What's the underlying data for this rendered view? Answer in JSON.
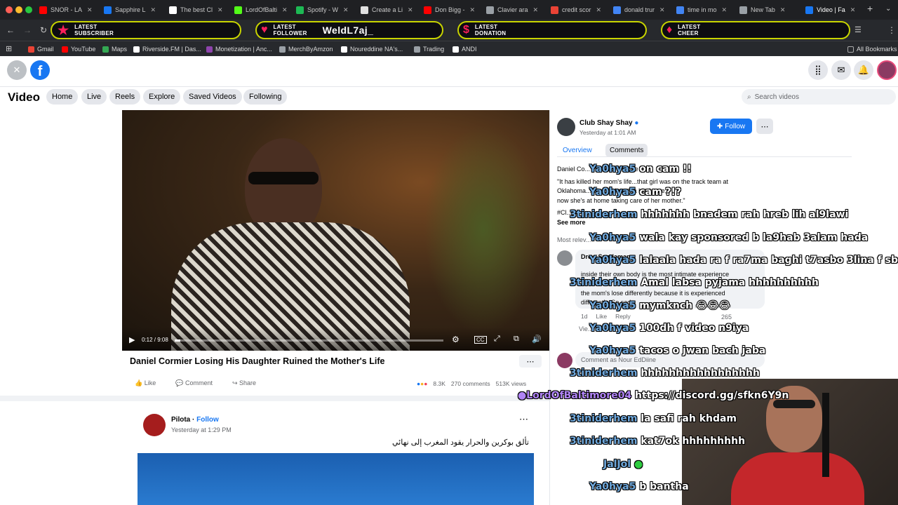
{
  "browser": {
    "tabs": [
      {
        "label": "SNOR - LA",
        "color": "#ff0000"
      },
      {
        "label": "Sapphire L",
        "color": "#1877f2"
      },
      {
        "label": "The best Cl",
        "color": "#ffffff"
      },
      {
        "label": "LordOfBalti",
        "color": "#53fc18"
      },
      {
        "label": "Spotify - W",
        "color": "#1db954"
      },
      {
        "label": "Create a Li",
        "color": "#e0e0e0"
      },
      {
        "label": "Don Bigg -",
        "color": "#ff0000"
      },
      {
        "label": "Clavier ara",
        "color": "#9aa0a6"
      },
      {
        "label": "credit scor",
        "color": "#ea4335"
      },
      {
        "label": "donald trur",
        "color": "#4285f4"
      },
      {
        "label": "time in mo",
        "color": "#4285f4"
      },
      {
        "label": "New Tab",
        "color": "#9aa0a6"
      },
      {
        "label": "Video | Fa",
        "color": "#1877f2"
      }
    ],
    "new_tab": "+"
  },
  "overlay": {
    "subscriber": {
      "title_1": "LATEST",
      "title_2": "SUBSCRIBER",
      "value": ""
    },
    "follower": {
      "title_1": "LATEST",
      "title_2": "FOLLOWER",
      "value": "WeldL7aj_"
    },
    "donation": {
      "title_1": "LATEST",
      "title_2": "DONATION",
      "value": ""
    },
    "cheer": {
      "title_1": "LATEST",
      "title_2": "CHEER",
      "value": ""
    }
  },
  "bookmarks": [
    {
      "label": "Gmail",
      "color": "#ea4335"
    },
    {
      "label": "YouTube",
      "color": "#ff0000"
    },
    {
      "label": "Maps",
      "color": "#34a853"
    },
    {
      "label": "Riverside.FM | Das...",
      "color": "#ffffff"
    },
    {
      "label": "Monetization | Anc...",
      "color": "#8e44ad"
    },
    {
      "label": "MerchByAmzon",
      "color": "#9aa0a6"
    },
    {
      "label": "Noureddine NA's...",
      "color": "#ffffff"
    },
    {
      "label": "Trading",
      "color": "#9aa0a6"
    },
    {
      "label": "ANDI",
      "color": "#ffffff"
    }
  ],
  "all_bookmarks": "All Bookmarks",
  "fb": {
    "page_title": "Video",
    "nav": [
      "Home",
      "Live",
      "Reels",
      "Explore",
      "Saved Videos",
      "Following"
    ],
    "search_placeholder": "Search videos",
    "video": {
      "time": "0:12 / 9:08",
      "title": "Daniel Cormier Losing His Daughter Ruined the Mother's Life",
      "like": "Like",
      "comment": "Comment",
      "share": "Share",
      "reactions": "8.3K",
      "comments": "270 comments",
      "views": "513K views"
    },
    "post2": {
      "author": "Pilota",
      "follow": "Follow",
      "time": "Yesterday at 1:29 PM",
      "text": "تألق بوكرين والحرار يقود المغرب إلى نهائي"
    },
    "side": {
      "author": "Club Shay Shay",
      "time": "Yesterday at 1:01 AM",
      "follow": "Follow",
      "tab_overview": "Overview",
      "tab_comments": "Comments",
      "desc_1": "Daniel Co... the Mother's Life",
      "desc_2": "\"It has killed her mom's life...that girl was on the track team at",
      "desc_3": "Oklahoma... She had such a big future,",
      "desc_4": "now she's at home taking care of her mother.\"",
      "desc_5": "#Cl...",
      "see_more": "See more",
      "most_rel": "Most relev...",
      "c1_name": "Drew Sundaman...",
      "c1_l1": "inside their own body is the most intimate experience",
      "c1_l2": "the mom's lose differently because it is experienced",
      "c1_l3": "differently. So sad.",
      "c1_time": "1d",
      "c1_like": "Like",
      "c1_reply": "Reply",
      "c1_count": "265",
      "view_more": "Vie...",
      "comment_as": "Comment as Nour EdDiine"
    }
  },
  "chat": [
    {
      "user": "Ya0hya5",
      "msg": "on cam !!"
    },
    {
      "user": "Ya0hya5",
      "msg": "cam ?!?"
    },
    {
      "user": "3tiniderhem",
      "msg": "hhhhhhh bnadem rah hreb lih al9lawi"
    },
    {
      "user": "Ya0hya5",
      "msg": "wala kay sponsored b la9hab 3alam hada"
    },
    {
      "user": "Ya0hya5",
      "msg": "lalaala hada ra f ra7ma baghi t7asbo 3lina f sba"
    },
    {
      "user": "3tiniderhem",
      "msg": "Amal labsa pyjama hhhhhhhhhh"
    },
    {
      "user": "Ya0hya5",
      "msg": "mymknch 😂😂😂"
    },
    {
      "user": "Ya0hya5",
      "msg": "100dh f video n9iya"
    },
    {
      "user": "Ya0hya5",
      "msg": "tacos o jwan bach jaba"
    },
    {
      "user": "3tiniderhem",
      "msg": "hhhhhhhhhhhhhhhhh"
    },
    {
      "user": "LordOfBaltimore04",
      "msg": "https://discord.gg/sfkn6Y9n"
    },
    {
      "user": "3tiniderhem",
      "msg": "la safi rah khdam"
    },
    {
      "user": "3tiniderhem",
      "msg": "kat7ok hhhhhhhhh"
    },
    {
      "user": "JalJol",
      "msg": ""
    },
    {
      "user": "Ya0hya5",
      "msg": "b bantha"
    }
  ]
}
